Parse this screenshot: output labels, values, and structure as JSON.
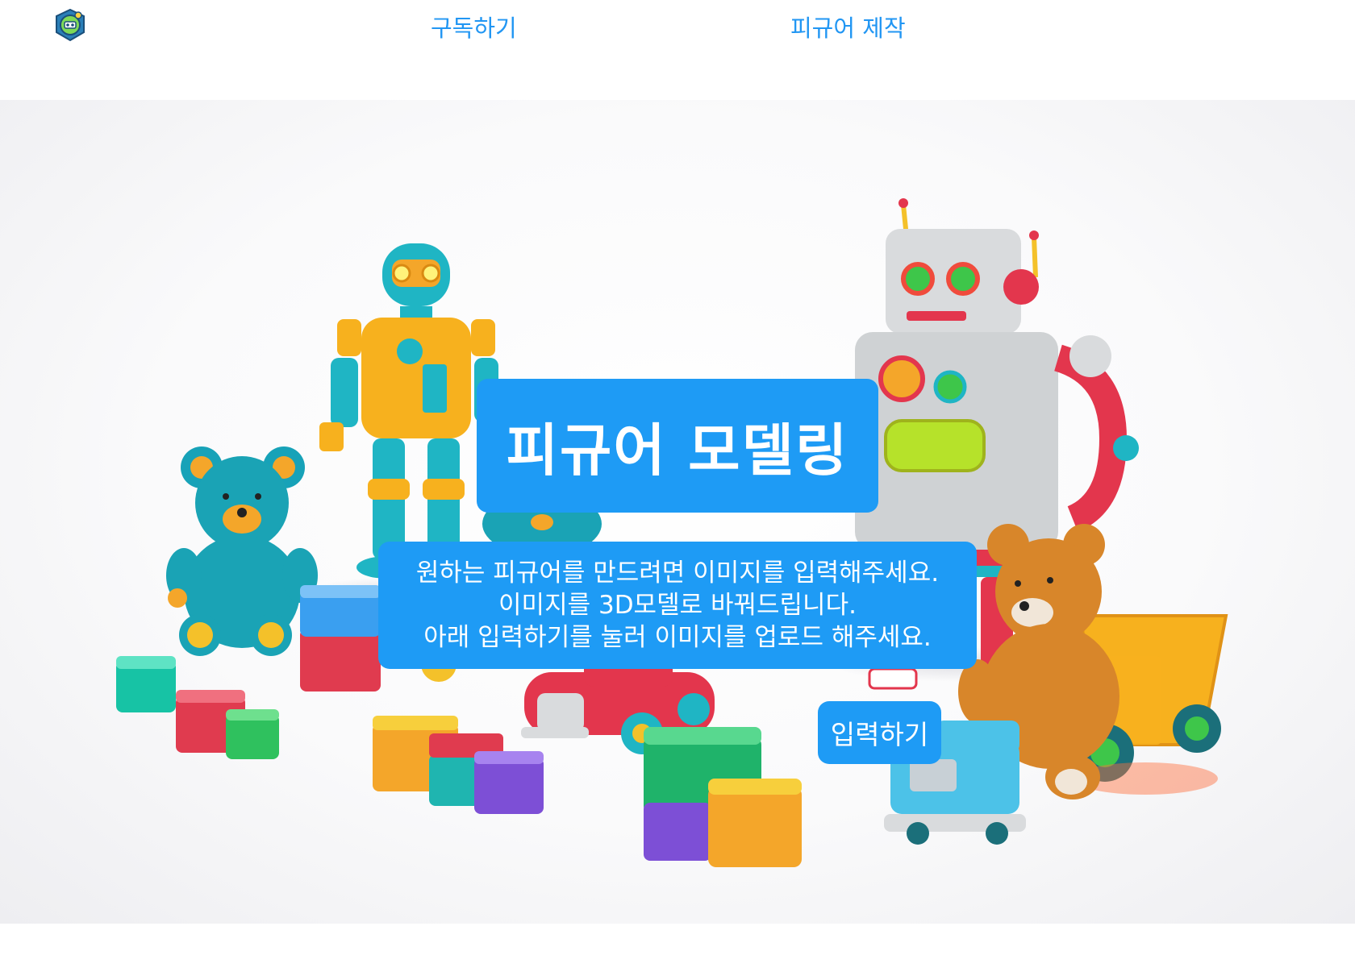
{
  "nav": {
    "logo_icon": "figure-logo-icon",
    "subscribe_label": "구독하기",
    "figure_label": "피규어 제작"
  },
  "hero": {
    "background_image": "toy-robots-bears-blocks-illustration",
    "title": "피규어 모델링",
    "description": [
      "원하는 피규어를 만드려면 이미지를 입력해주세요.",
      "이미지를 3D모델로 바꿔드립니다.",
      "아래 입력하기를 눌러 이미지를 업로드 해주세요."
    ],
    "upload_label": "입력하기"
  },
  "colors": {
    "accent": "#1E9BF5",
    "link": "#2196F3",
    "text_on_accent": "#ffffff"
  }
}
